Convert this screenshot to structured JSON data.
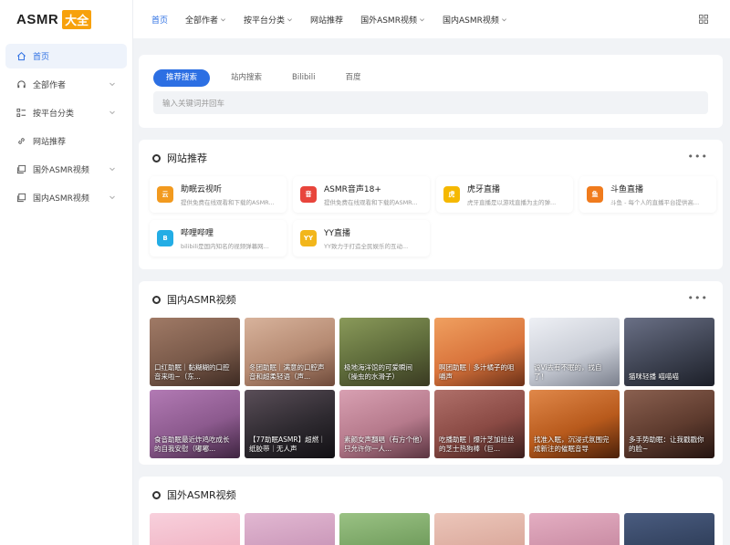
{
  "brand": {
    "name": "ASMR",
    "badge": "大全",
    "badge_color": "#f7a10c"
  },
  "sidebar": {
    "items": [
      {
        "label": "首页",
        "icon": "home-icon",
        "active": true
      },
      {
        "label": "全部作者",
        "icon": "headphones-icon",
        "has_chevron": true
      },
      {
        "label": "按平台分类",
        "icon": "list-icon",
        "has_chevron": true
      },
      {
        "label": "网站推荐",
        "icon": "link-icon"
      },
      {
        "label": "国外ASMR视频",
        "icon": "video-icon",
        "has_chevron": true
      },
      {
        "label": "国内ASMR视频",
        "icon": "video-icon",
        "has_chevron": true
      }
    ]
  },
  "topnav": {
    "items": [
      {
        "label": "首页",
        "active": true
      },
      {
        "label": "全部作者",
        "has_chevron": true
      },
      {
        "label": "按平台分类",
        "has_chevron": true
      },
      {
        "label": "网站推荐"
      },
      {
        "label": "国外ASMR视频",
        "has_chevron": true
      },
      {
        "label": "国内ASMR视频",
        "has_chevron": true
      }
    ],
    "grid_icon": "grid-icon"
  },
  "search": {
    "tabs": [
      "推荐搜索",
      "站内搜索",
      "Bilibili",
      "百度"
    ],
    "active_tab": 0,
    "placeholder": "输入关键词并回车"
  },
  "sites": {
    "title": "网站推荐",
    "more": "•••",
    "items": [
      {
        "name": "助眠云视听",
        "desc": "提供免费在线观看和下载的ASMR...",
        "logo_color": "#f29a1f",
        "logo": "云"
      },
      {
        "name": "ASMR音声18+",
        "desc": "提供免费在线观看和下载的ASMR...",
        "logo_color": "#e8453c",
        "logo": "音"
      },
      {
        "name": "虎牙直播",
        "desc": "虎牙直播是以游戏直播为主的弹...",
        "logo_color": "#f5b800",
        "logo": "虎"
      },
      {
        "name": "斗鱼直播",
        "desc": "斗鱼 - 每个人的直播平台提供高...",
        "logo_color": "#f07b1d",
        "logo": "鱼"
      },
      {
        "name": "哔哩哔哩",
        "desc": "bilibili是国内知名的视频弹幕网...",
        "logo_color": "#23ade5",
        "logo": "B"
      },
      {
        "name": "YY直播",
        "desc": "YY致力于打造全民娱乐的互动...",
        "logo_color": "#f2b61b",
        "logo": "YY"
      }
    ]
  },
  "domestic": {
    "title": "国内ASMR视频",
    "more": "•••",
    "videos": [
      {
        "title": "口红助眠｜黏糊糊的口腔音来啦~（东...",
        "color": "#7a5a4a"
      },
      {
        "title": "冬团助眠｜满意的口腔声音和超柔轻语（声...",
        "color": "#b58a72"
      },
      {
        "title": "极地海洋馆的可爱瞬间（操虫的水滑子）",
        "color": "#5d6a3a"
      },
      {
        "title": "啊团助眠｜多汁橘子的咀嚼声",
        "color": "#d9743c"
      },
      {
        "title": "说Vi去有不眠的，找自了！",
        "color": "#c9cdd6"
      },
      {
        "title": "猫咪轻播 喵喵喵",
        "color": "#3e4352"
      },
      {
        "title": "食音助眠最近炸鸡吃成长的自我安慰（嘟嘟...",
        "color": "#8c5a8e"
      },
      {
        "title": "【77助眠ASMR】超燃｜纸胶带｜无人声",
        "color": "#2e2a30"
      },
      {
        "title": "素颜女声翻唱（有方个他）只允许你一人...",
        "color": "#b67a8c"
      },
      {
        "title": "吃播助眠｜爆汁芝加拉丝的芝士热狗棒（巨...",
        "color": "#8a4a44"
      },
      {
        "title": "找准入眠，沉浸式氛围完成新注的催眠音导",
        "color": "#b85a1c"
      },
      {
        "title": "多手势助眠：让我戳戳你的脸~",
        "color": "#5e3b2e"
      }
    ]
  },
  "international": {
    "title": "国外ASMR视频",
    "videos": [
      {
        "color": "#f0b4c4"
      },
      {
        "color": "#c996b8"
      },
      {
        "color": "#6e9a5a"
      },
      {
        "color": "#d9a79a"
      },
      {
        "color": "#c88aa2"
      },
      {
        "color": "#2e3d58"
      }
    ]
  }
}
